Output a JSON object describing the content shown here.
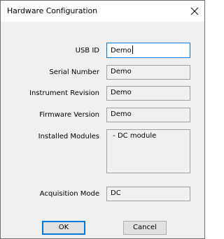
{
  "window": {
    "title": "Hardware Configuration",
    "close_icon": "close-icon"
  },
  "fields": {
    "usb_id": {
      "label": "USB ID",
      "value": "Demo"
    },
    "serial_number": {
      "label": "Serial Number",
      "value": "Demo"
    },
    "instrument_revision": {
      "label": "Instrument Revision",
      "value": "Demo"
    },
    "firmware_version": {
      "label": "Firmware Version",
      "value": "Demo"
    },
    "installed_modules": {
      "label": "Installed Modules",
      "value": " - DC module"
    },
    "acquisition_mode": {
      "label": "Acquisition Mode",
      "value": "DC"
    }
  },
  "buttons": {
    "ok": "OK",
    "cancel": "Cancel"
  },
  "colors": {
    "accent": "#0078d7",
    "panel": "#f0f0f0",
    "button_face": "#e1e1e1"
  }
}
